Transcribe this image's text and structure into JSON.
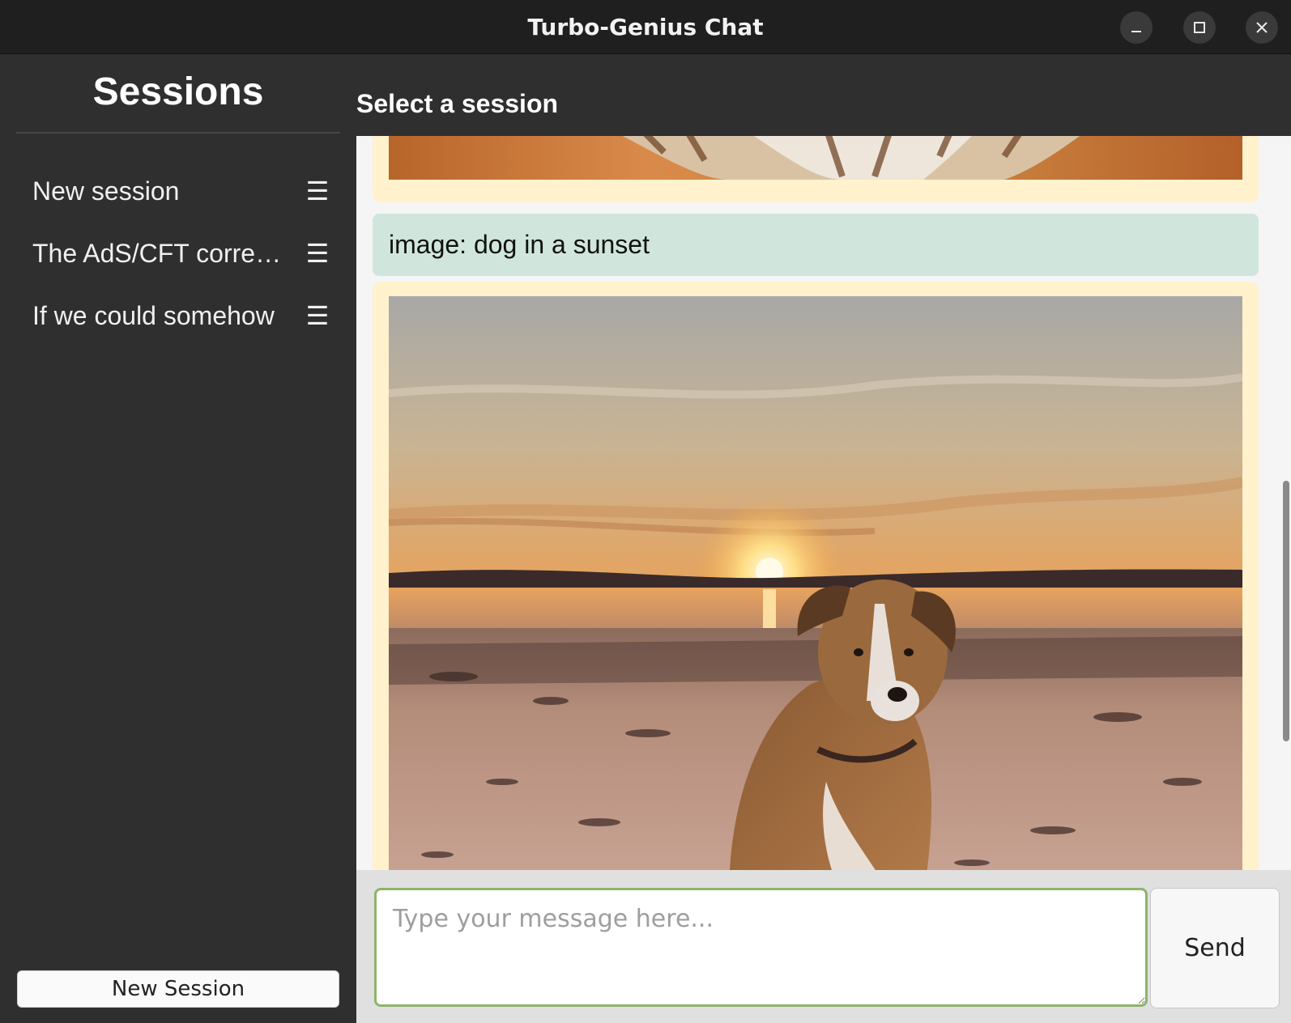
{
  "window": {
    "title": "Turbo-Genius Chat",
    "controls": [
      "minimize-icon",
      "maximize-icon",
      "close-icon"
    ]
  },
  "sidebar": {
    "title": "Sessions",
    "items": [
      {
        "label": "New session",
        "icon": "hamburger-menu-icon"
      },
      {
        "label": "The AdS/CFT correspondence",
        "icon": "hamburger-menu-icon"
      },
      {
        "label": "If we could somehow",
        "icon": "hamburger-menu-icon"
      }
    ],
    "new_session_button": "New Session"
  },
  "main": {
    "header": "Select a session",
    "messages": [
      {
        "role": "assistant",
        "type": "image",
        "subject": "cat"
      },
      {
        "role": "user",
        "text": "image: dog in a sunset"
      },
      {
        "role": "assistant",
        "type": "image",
        "subject": "dog in a sunset"
      }
    ]
  },
  "composer": {
    "placeholder": "Type your message here...",
    "value": "",
    "send_label": "Send"
  },
  "colors": {
    "sidebar_bg": "#2f2f2f",
    "titlebar_bg": "#1f1f1f",
    "chat_bg": "#f5f5f5",
    "assistant_bubble": "#fff2cc",
    "user_bubble": "#d0e6dc",
    "input_border": "#8fb46a"
  }
}
